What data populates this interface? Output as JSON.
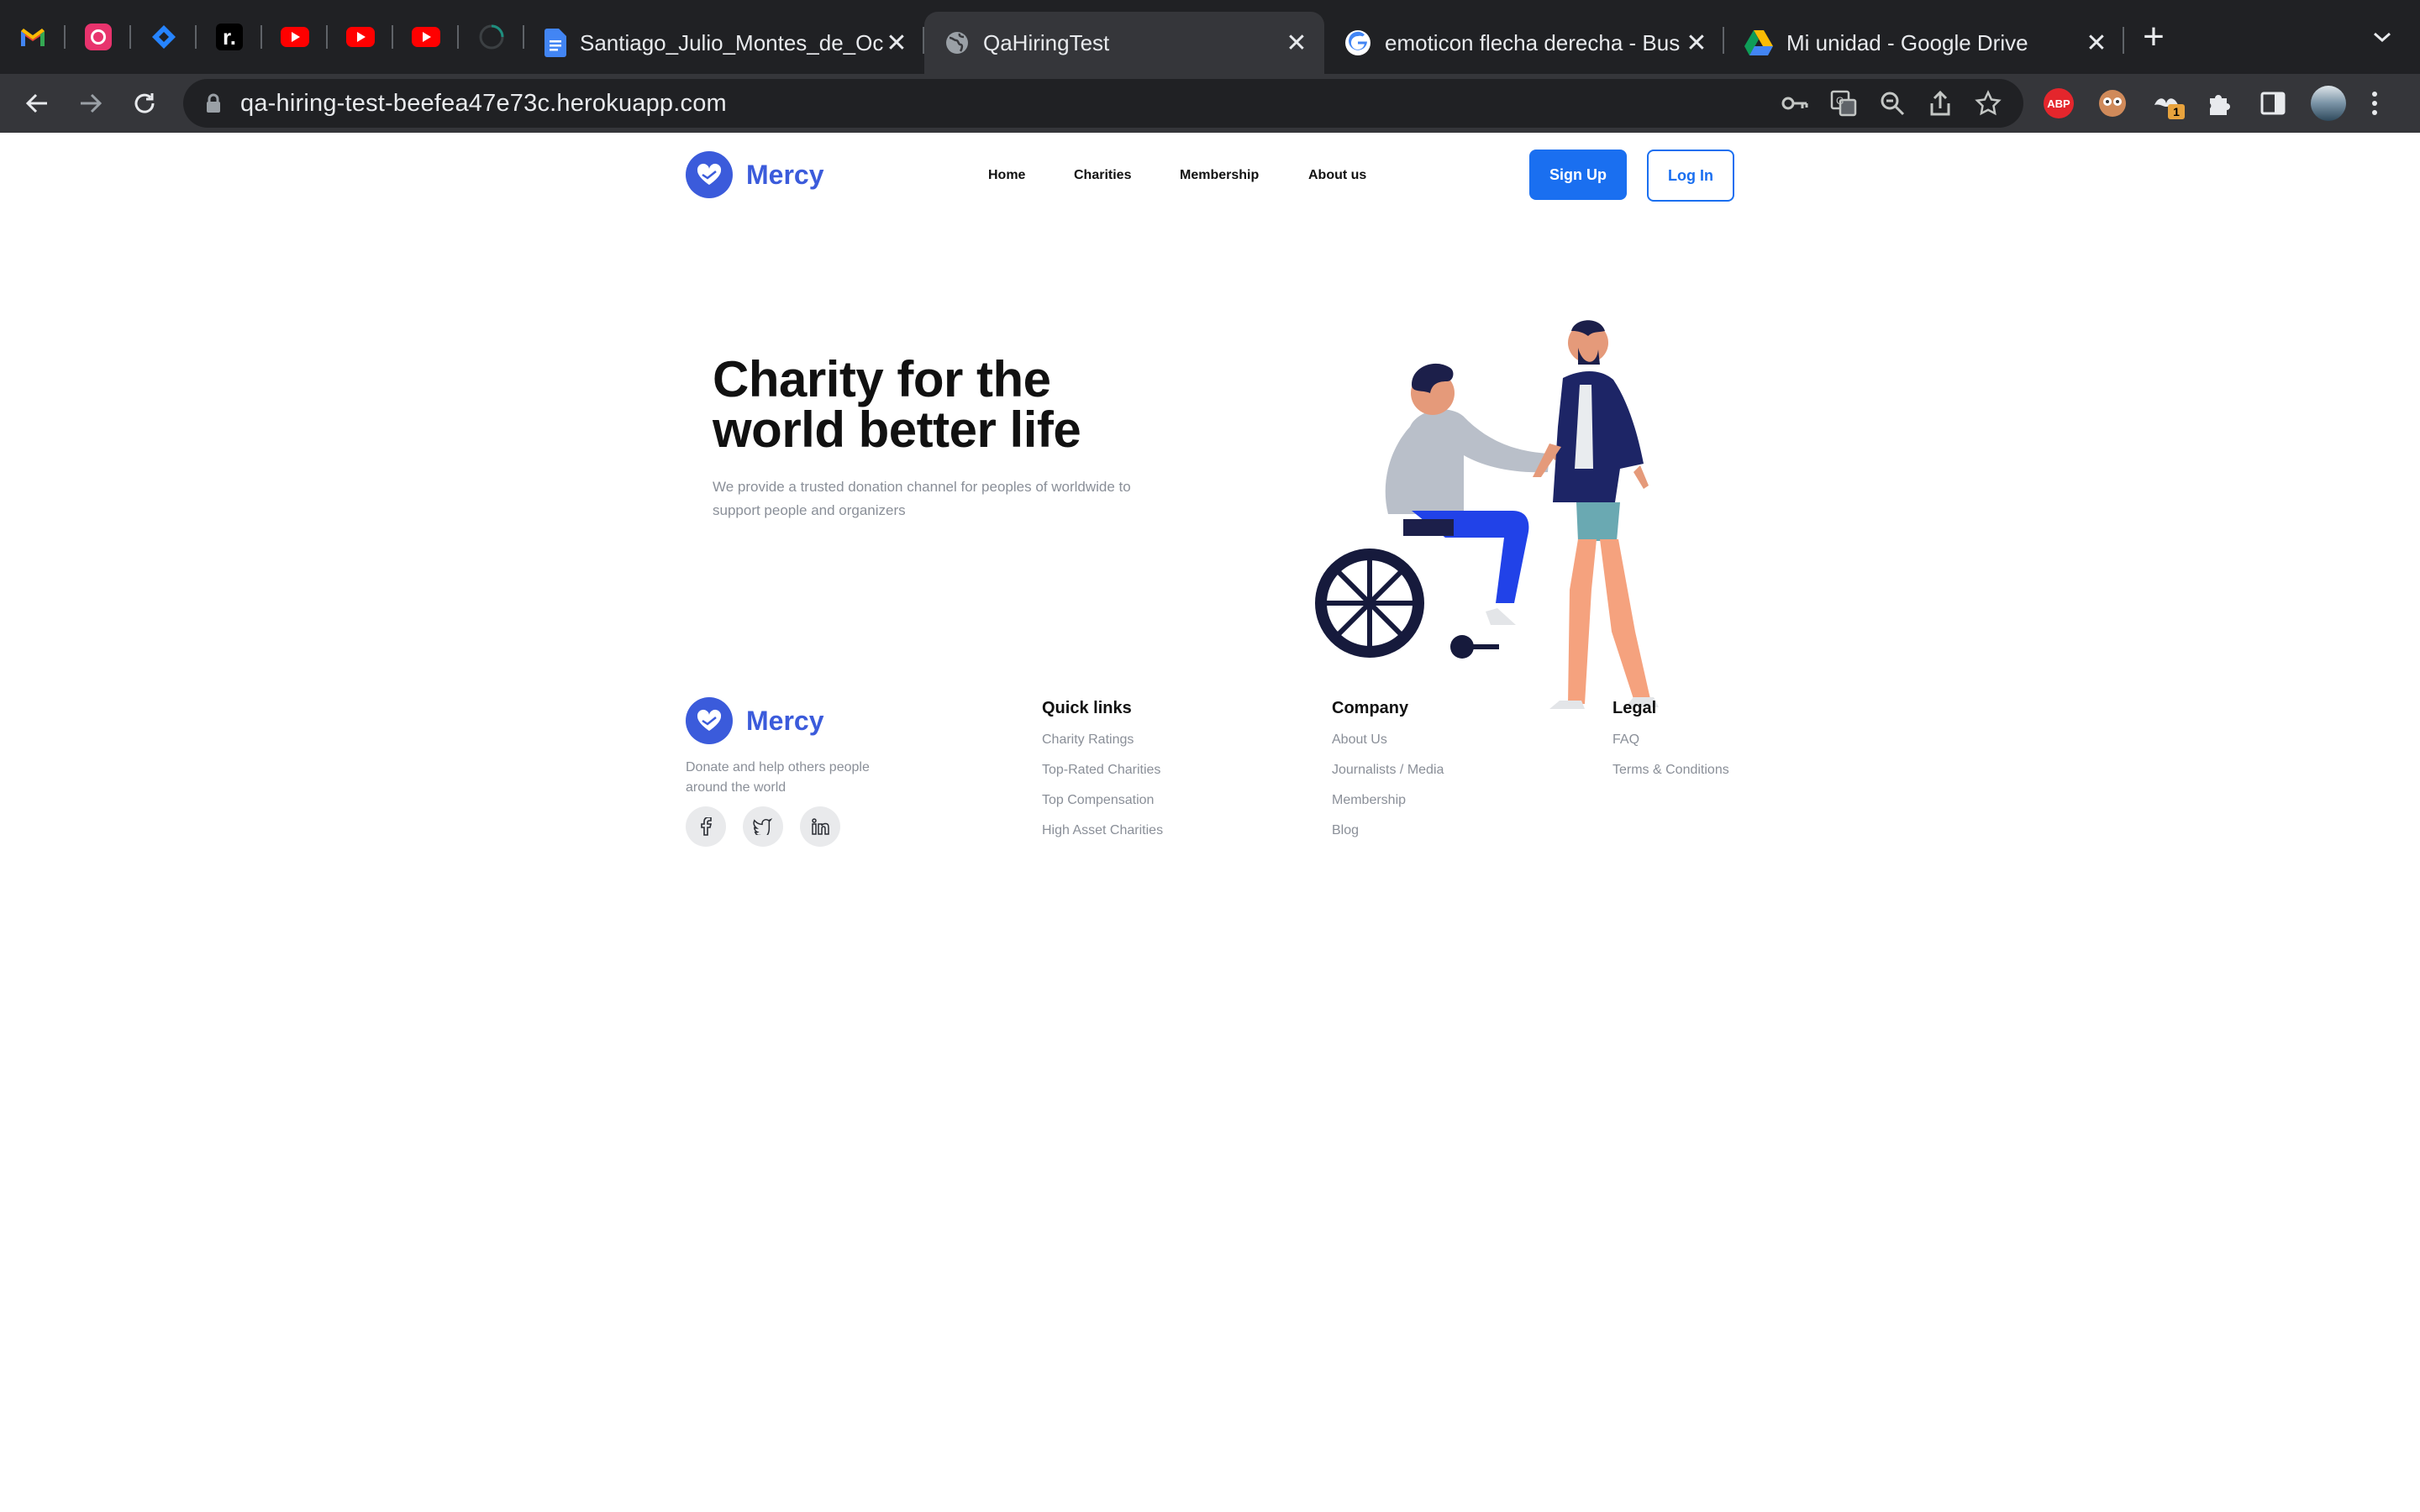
{
  "browser": {
    "tabs": [
      {
        "title": "Santiago_Julio_Montes_de_Oc"
      },
      {
        "title": "QaHiringTest"
      },
      {
        "title": "emoticon flecha derecha - Bus"
      },
      {
        "title": "Mi unidad - Google Drive"
      }
    ],
    "pinned_icons": [
      "gmail-icon",
      "calendar-icon",
      "jira-icon",
      "readwise-icon",
      "youtube-icon",
      "youtube-icon",
      "youtube-icon",
      "loading-icon"
    ],
    "url": "qa-hiring-test-beefea47e73c.herokuapp.com",
    "extensions": {
      "abp_label": "ABP",
      "badge_count": "1"
    }
  },
  "header": {
    "brand": "Mercy",
    "nav": [
      "Home",
      "Charities",
      "Membership",
      "About us"
    ],
    "signup_label": "Sign Up",
    "login_label": "Log In"
  },
  "hero": {
    "title_line1": "Charity for the",
    "title_line2": "world better life",
    "subtitle_line1": "We provide a trusted donation channel for peoples of worldwide to",
    "subtitle_line2": "support people and organizers"
  },
  "footer": {
    "brand": "Mercy",
    "desc_line1": "Donate and help others people",
    "desc_line2": "around the world",
    "social": [
      "facebook-icon",
      "twitter-icon",
      "linkedin-icon"
    ],
    "quick_links": {
      "title": "Quick links",
      "items": [
        "Charity Ratings",
        "Top-Rated Charities",
        "Top Compensation",
        "High Asset Charities"
      ]
    },
    "company": {
      "title": "Company",
      "items": [
        "About Us",
        "Journalists / Media",
        "Membership",
        "Blog"
      ]
    },
    "legal": {
      "title": "Legal",
      "items": [
        "FAQ",
        "Terms & Conditions"
      ]
    }
  },
  "colors": {
    "brand": "#3b5bdb",
    "primary_button": "#1a6ff0",
    "chrome_dark": "#202124",
    "chrome_mid": "#35363a"
  }
}
